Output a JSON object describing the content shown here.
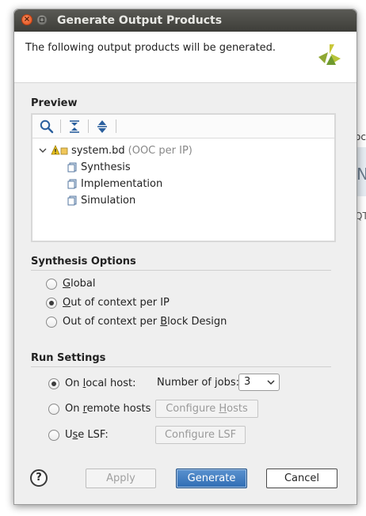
{
  "background_app": {
    "text_top": "oc",
    "text_mid": "N",
    "text_bottom": "QT"
  },
  "dialog": {
    "title": "Generate Output Products",
    "description": "The following output products will be generated.",
    "logo_icon": "xilinx-logo-icon",
    "accent_color": "#2f6db4"
  },
  "preview": {
    "label": "Preview",
    "toolbar_icons": [
      "search-icon",
      "collapse-all-icon",
      "expand-all-icon"
    ],
    "root": {
      "name": "system.bd",
      "note": "(OOC per IP)"
    },
    "children": [
      {
        "label": "Synthesis"
      },
      {
        "label": "Implementation"
      },
      {
        "label": "Simulation"
      }
    ]
  },
  "synthesis_options": {
    "label": "Synthesis Options",
    "options": [
      {
        "label_u": "G",
        "label_rest": "lobal",
        "checked": false
      },
      {
        "label_u": "O",
        "label_rest": "ut of context per IP",
        "checked": true
      },
      {
        "label_pre": "Out of context per ",
        "label_u": "B",
        "label_rest": "lock Design",
        "checked": false
      }
    ]
  },
  "run_settings": {
    "label": "Run Settings",
    "local": {
      "pre": "On ",
      "u": "l",
      "rest": "ocal host:",
      "checked": true
    },
    "jobs_label": "Number of jobs:",
    "jobs_value": "3",
    "remote": {
      "pre": "On ",
      "u": "r",
      "rest": "emote hosts",
      "checked": false
    },
    "configure_hosts": {
      "pre": "Configure ",
      "u": "H",
      "rest": "osts"
    },
    "lsf": {
      "pre": "U",
      "u": "s",
      "rest": "e LSF:",
      "checked": false
    },
    "configure_lsf": "Configure LSF"
  },
  "buttons": {
    "help": "?",
    "apply": "Apply",
    "generate": "Generate",
    "cancel": "Cancel"
  }
}
